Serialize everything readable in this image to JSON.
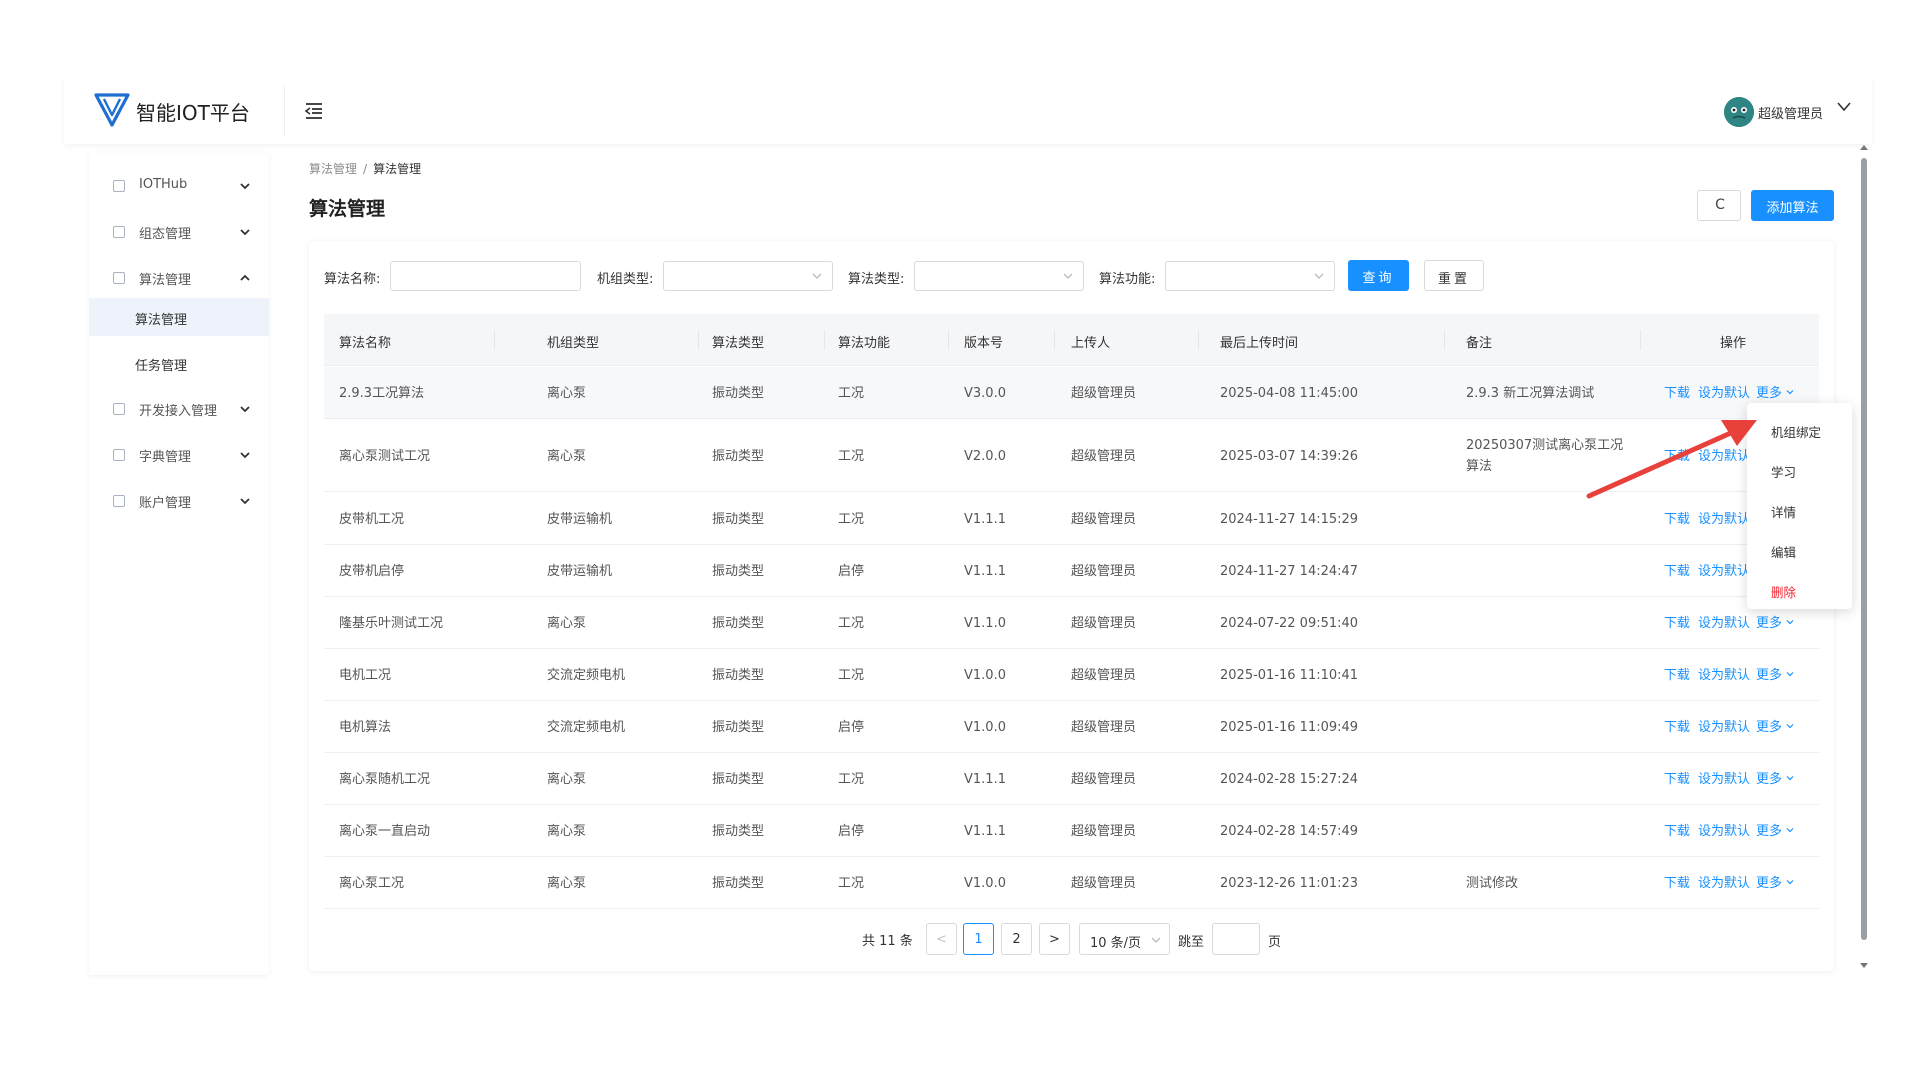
{
  "app": {
    "title": "智能IOT平台",
    "user_name": "超级管理员"
  },
  "icons": {
    "logo": "v-logo-icon",
    "fold": "menu-fold-icon",
    "avatar": "user-avatar",
    "user_caret": "chevron-down-icon",
    "refresh": "refresh-icon"
  },
  "colors": {
    "primary": "#1890ff",
    "danger": "#f5222d",
    "annotation_arrow": "#e8403a",
    "sidebar_active_bg": "#eef3fb"
  },
  "sidebar": {
    "items": [
      {
        "label": "IOTHub",
        "icon": "grid-icon",
        "expanded": false
      },
      {
        "label": "组态管理",
        "icon": "dashboard-icon",
        "expanded": false
      },
      {
        "label": "算法管理",
        "icon": "algorithm-icon",
        "expanded": true
      },
      {
        "label": "开发接入管理",
        "icon": "dev-access-icon",
        "expanded": false
      },
      {
        "label": "字典管理",
        "icon": "dictionary-icon",
        "expanded": false
      },
      {
        "label": "账户管理",
        "icon": "account-icon",
        "expanded": false
      }
    ],
    "sub_items": [
      {
        "label": "算法管理",
        "active": true
      },
      {
        "label": "任务管理",
        "active": false
      }
    ]
  },
  "breadcrumb": {
    "parent": "算法管理",
    "separator": "/",
    "current": "算法管理"
  },
  "page": {
    "title": "算法管理",
    "refresh_label": "C",
    "add_label": "添加算法"
  },
  "filters": {
    "name_label": "算法名称:",
    "name_value": "",
    "unit_type_label": "机组类型:",
    "unit_type_value": "",
    "algo_type_label": "算法类型:",
    "algo_type_value": "",
    "function_label": "算法功能:",
    "function_value": "",
    "query_label": "查询",
    "reset_label": "重置"
  },
  "table": {
    "columns": [
      "算法名称",
      "机组类型",
      "算法类型",
      "算法功能",
      "版本号",
      "上传人",
      "最后上传时间",
      "备注",
      "操作"
    ],
    "action_labels": {
      "download": "下载",
      "set_default": "设为默认",
      "more": "更多"
    },
    "rows": [
      {
        "name": "2.9.3工况算法",
        "unit_type": "离心泵",
        "algo_type": "振动类型",
        "function": "工况",
        "version": "V3.0.0",
        "uploader": "超级管理员",
        "time": "2025-04-08 11:45:00",
        "remark": "2.9.3 新工况算法调试"
      },
      {
        "name": "离心泵测试工况",
        "unit_type": "离心泵",
        "algo_type": "振动类型",
        "function": "工况",
        "version": "V2.0.0",
        "uploader": "超级管理员",
        "time": "2025-03-07 14:39:26",
        "remark": "20250307测试离心泵工况算法"
      },
      {
        "name": "皮带机工况",
        "unit_type": "皮带运输机",
        "algo_type": "振动类型",
        "function": "工况",
        "version": "V1.1.1",
        "uploader": "超级管理员",
        "time": "2024-11-27 14:15:29",
        "remark": ""
      },
      {
        "name": "皮带机启停",
        "unit_type": "皮带运输机",
        "algo_type": "振动类型",
        "function": "启停",
        "version": "V1.1.1",
        "uploader": "超级管理员",
        "time": "2024-11-27 14:24:47",
        "remark": ""
      },
      {
        "name": "隆基乐叶测试工况",
        "unit_type": "离心泵",
        "algo_type": "振动类型",
        "function": "工况",
        "version": "V1.1.0",
        "uploader": "超级管理员",
        "time": "2024-07-22 09:51:40",
        "remark": ""
      },
      {
        "name": "电机工况",
        "unit_type": "交流定频电机",
        "algo_type": "振动类型",
        "function": "工况",
        "version": "V1.0.0",
        "uploader": "超级管理员",
        "time": "2025-01-16 11:10:41",
        "remark": ""
      },
      {
        "name": "电机算法",
        "unit_type": "交流定频电机",
        "algo_type": "振动类型",
        "function": "启停",
        "version": "V1.0.0",
        "uploader": "超级管理员",
        "time": "2025-01-16 11:09:49",
        "remark": ""
      },
      {
        "name": "离心泵随机工况",
        "unit_type": "离心泵",
        "algo_type": "振动类型",
        "function": "工况",
        "version": "V1.1.1",
        "uploader": "超级管理员",
        "time": "2024-02-28 15:27:24",
        "remark": ""
      },
      {
        "name": "离心泵一直启动",
        "unit_type": "离心泵",
        "algo_type": "振动类型",
        "function": "启停",
        "version": "V1.1.1",
        "uploader": "超级管理员",
        "time": "2024-02-28 14:57:49",
        "remark": ""
      },
      {
        "name": "离心泵工况",
        "unit_type": "离心泵",
        "algo_type": "振动类型",
        "function": "工况",
        "version": "V1.0.0",
        "uploader": "超级管理员",
        "time": "2023-12-26 11:01:23",
        "remark": "测试修改"
      }
    ]
  },
  "more_menu": {
    "open_on_row": 1,
    "items": [
      {
        "label": "机组绑定",
        "danger": false
      },
      {
        "label": "学习",
        "danger": false
      },
      {
        "label": "详情",
        "danger": false
      },
      {
        "label": "编辑",
        "danger": false
      },
      {
        "label": "删除",
        "danger": true
      }
    ]
  },
  "pagination": {
    "total_label": "共 11 条",
    "prev": "<",
    "pages": [
      "1",
      "2"
    ],
    "current_page": "1",
    "next": ">",
    "page_size": "10 条/页",
    "jump_label": "跳至",
    "jump_value": "",
    "page_unit": "页"
  }
}
